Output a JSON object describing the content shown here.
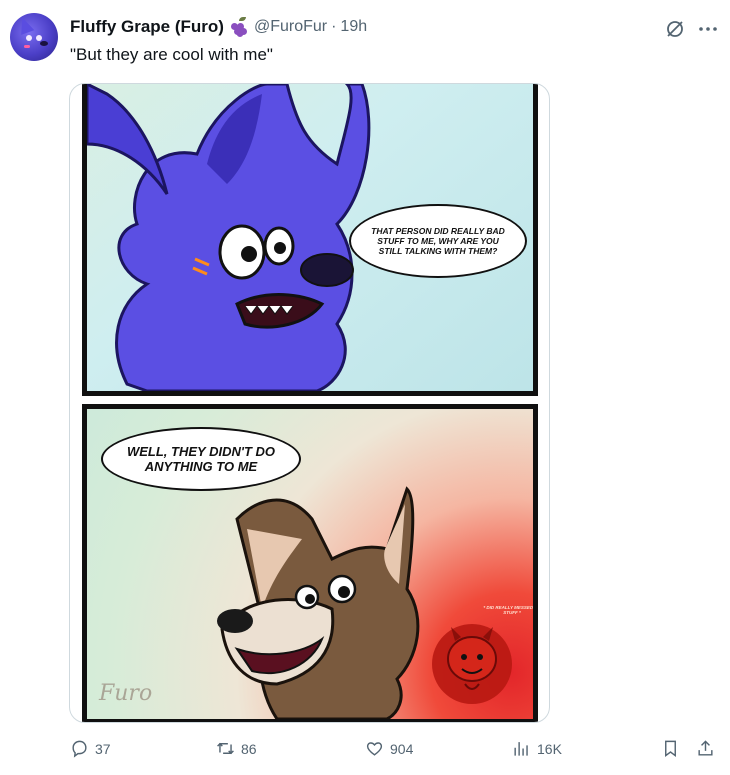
{
  "tweet": {
    "display_name": "Fluffy Grape (Furo)",
    "handle": "@FuroFur",
    "separator": "·",
    "time": "19h",
    "text": "\"But they are cool with me\""
  },
  "comic": {
    "bubble_top": "THAT PERSON DID REALLY BAD STUFF TO ME, WHY ARE YOU STILL TALKING WITH THEM?",
    "bubble_bottom": "WELL, THEY DIDN'T DO ANYTHING TO ME",
    "small_caption": "* DID REALLY MESSED UP STUFF *",
    "signature": "Furo"
  },
  "actions": {
    "replies": "37",
    "reposts": "86",
    "likes": "904",
    "views": "16K"
  },
  "icons": {
    "verified_emoji": "grape-icon",
    "grok": "grok-icon",
    "more": "more-icon",
    "reply": "reply-icon",
    "repost": "repost-icon",
    "like": "heart-icon",
    "views": "views-icon",
    "bookmark": "bookmark-icon",
    "share": "share-icon"
  },
  "colors": {
    "text_primary": "#0f1419",
    "text_secondary": "#536471",
    "border": "#cfd9de"
  }
}
